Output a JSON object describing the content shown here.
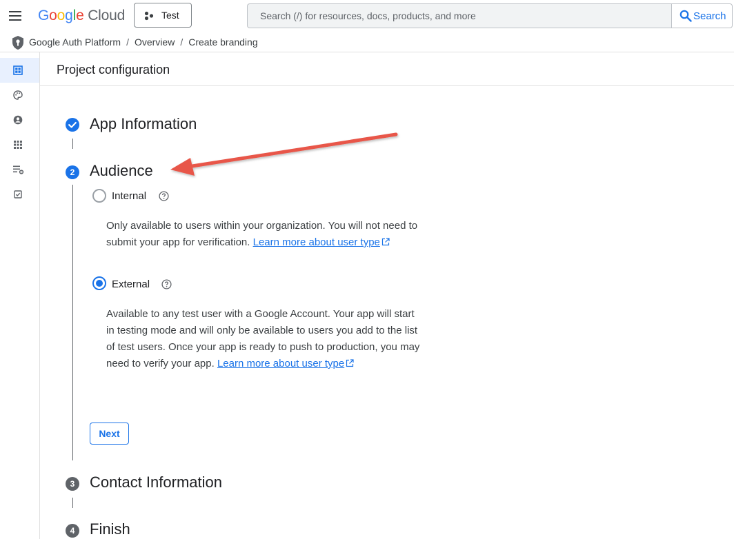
{
  "header": {
    "logo": {
      "google": [
        "G",
        "o",
        "o",
        "g",
        "l",
        "e"
      ],
      "product": "Cloud"
    },
    "project_label": "Test",
    "search": {
      "placeholder": "Search (/) for resources, docs, products, and more",
      "button_label": "Search"
    }
  },
  "breadcrumb": {
    "items": [
      "Google Auth Platform",
      "Overview",
      "Create branding"
    ]
  },
  "rail": {
    "icons": [
      "dashboard-icon",
      "palette-icon",
      "account-circle-icon",
      "apps-grid-icon",
      "data-access-icon",
      "verification-icon"
    ]
  },
  "page": {
    "title": "Project configuration"
  },
  "steps": [
    {
      "number": "✓",
      "title": "App Information",
      "state": "done"
    },
    {
      "number": "2",
      "title": "Audience",
      "state": "active"
    },
    {
      "number": "3",
      "title": "Contact Information",
      "state": "pending"
    },
    {
      "number": "4",
      "title": "Finish",
      "state": "pending"
    }
  ],
  "audience": {
    "options": [
      {
        "label": "Internal",
        "selected": false,
        "description": "Only available to users within your organization. You will not need to submit your app for verification.",
        "link": "Learn more about user type"
      },
      {
        "label": "External",
        "selected": true,
        "description": "Available to any test user with a Google Account. Your app will start in testing mode and will only be available to users you add to the list of test users. Once your app is ready to push to production, you may need to verify your app.",
        "link": "Learn more about user type"
      }
    ],
    "next_label": "Next"
  },
  "colors": {
    "accent": "#1a73e8",
    "annotation_arrow": "#e8574a",
    "pending_badge": "#5f6368"
  }
}
